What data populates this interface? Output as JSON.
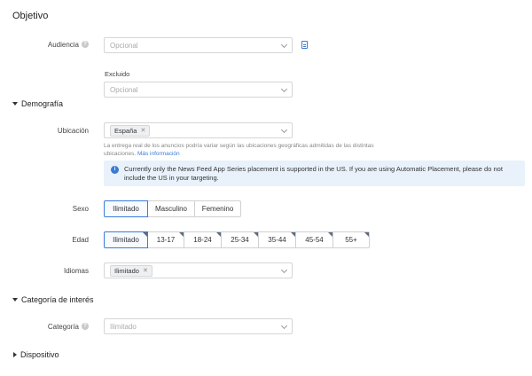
{
  "title": "Objetivo",
  "audience": {
    "label": "Audiencia",
    "placeholder": "Opcional",
    "excluded_label": "Excluido",
    "excluded_placeholder": "Opcional"
  },
  "demography": {
    "heading": "Demografía",
    "location": {
      "label": "Ubicación",
      "tag": "España",
      "hint": "La entrega real de los anuncios podría variar según las ubicaciones geográficas admitidas de las distintas ubicaciones.",
      "hint_link": "Más información"
    },
    "info": "Currently only the News Feed App Series placement is supported in the US. If you are using Automatic Placement, please do not include the US in your targeting.",
    "gender": {
      "label": "Sexo",
      "options": [
        "Ilimitado",
        "Masculino",
        "Femenino"
      ],
      "selected": "Ilimitado"
    },
    "age": {
      "label": "Edad",
      "options": [
        "Ilimitado",
        "13-17",
        "18-24",
        "25-34",
        "35-44",
        "45-54",
        "55+"
      ],
      "selected": "Ilimitado"
    },
    "languages": {
      "label": "Idiomas",
      "tag": "Ilimitado"
    }
  },
  "interest": {
    "heading": "Categoría de interés",
    "category": {
      "label": "Categoría",
      "placeholder": "Ilimitado"
    }
  },
  "device": {
    "heading": "Dispositivo"
  }
}
